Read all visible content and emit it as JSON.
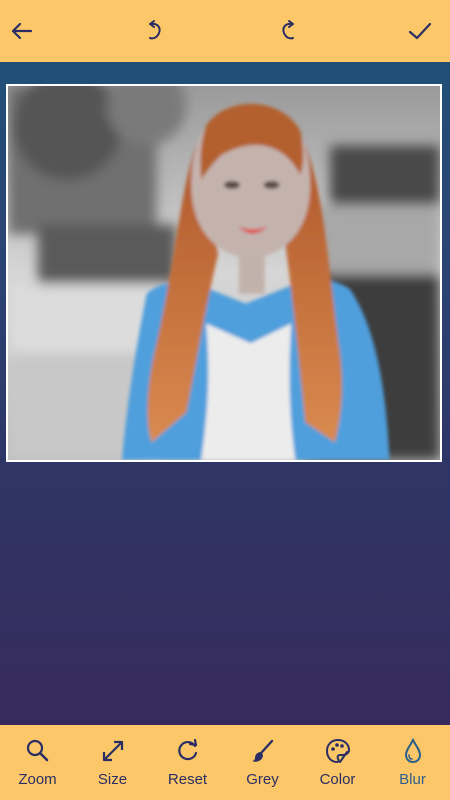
{
  "colors": {
    "bar_bg": "#fcc769",
    "icon_color": "#2b2e63",
    "active_color": "#2c5f8c",
    "frame_border": "#ffffff"
  },
  "topbar": {
    "back_icon": "arrow-left-icon",
    "undo_icon": "undo-icon",
    "redo_icon": "redo-icon",
    "done_icon": "checkmark-icon"
  },
  "tools": [
    {
      "label": "Zoom",
      "icon": "magnifier-icon"
    },
    {
      "label": "Size",
      "icon": "resize-arrows-icon"
    },
    {
      "label": "Reset",
      "icon": "reset-icon"
    },
    {
      "label": "Grey",
      "icon": "brush-icon"
    },
    {
      "label": "Color",
      "icon": "palette-icon"
    },
    {
      "label": "Blur",
      "icon": "water-drop-icon",
      "active": true
    }
  ]
}
